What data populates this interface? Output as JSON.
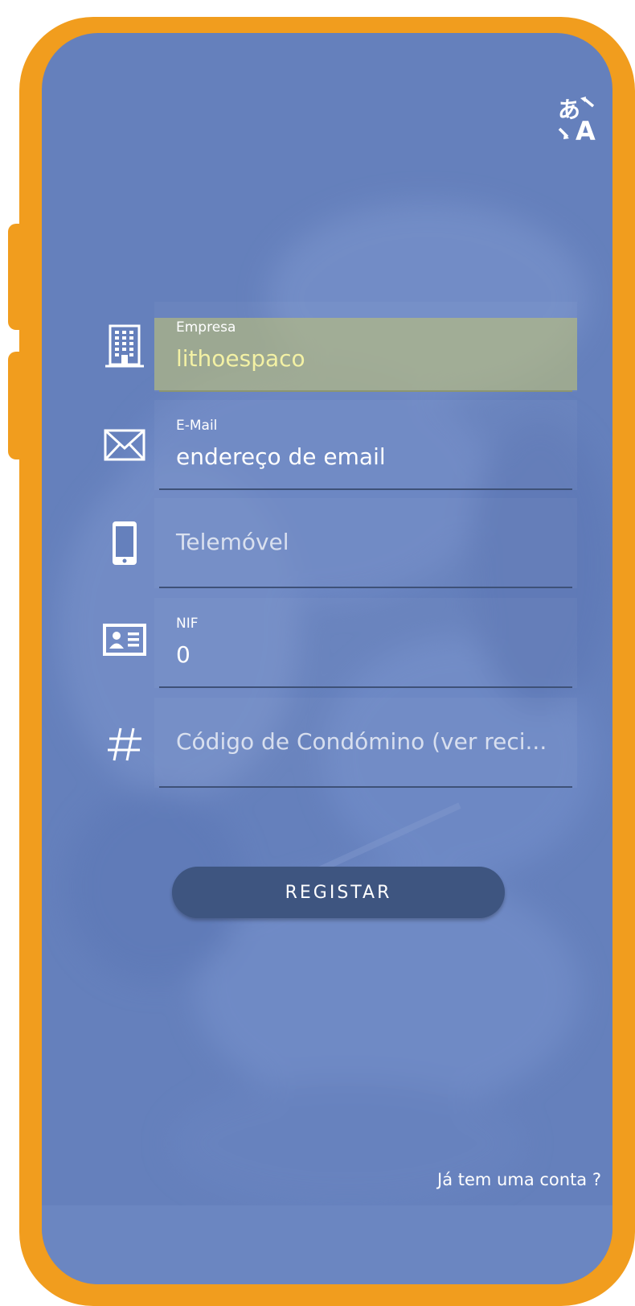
{
  "colors": {
    "frame": "#F19D1E",
    "screen_background": "#6580BC",
    "button": "#3E5580",
    "highlight": "#BBBE78"
  },
  "header": {
    "translate_icon": "translate-icon"
  },
  "form": {
    "empresa": {
      "icon": "building-icon",
      "label": "Empresa",
      "value": "lithoespaco"
    },
    "email": {
      "icon": "envelope-icon",
      "label": "E-Mail",
      "value": "endereço de email"
    },
    "telemovel": {
      "icon": "mobile-phone-icon",
      "placeholder": "Telemóvel"
    },
    "nif": {
      "icon": "id-card-icon",
      "label": "NIF",
      "value": "0"
    },
    "codigo": {
      "icon": "hash-icon",
      "placeholder": "Código de Condómino (ver reci..."
    }
  },
  "actions": {
    "register_label": "REGISTAR",
    "login_link": "Já tem uma conta ?"
  }
}
